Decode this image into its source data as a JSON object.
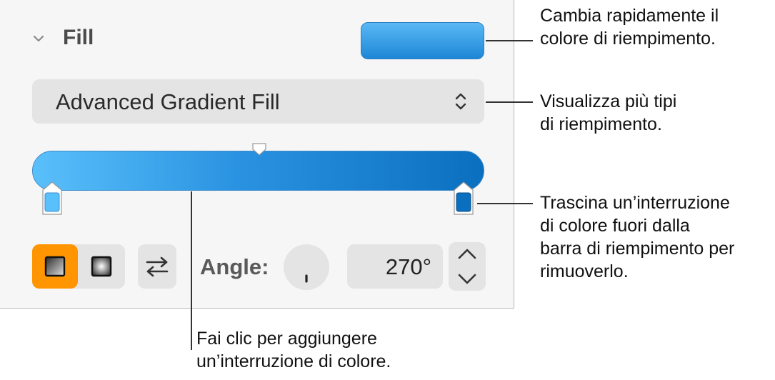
{
  "panel": {
    "section_title": "Fill",
    "fill_type": "Advanced Gradient Fill",
    "angle_label": "Angle:",
    "angle_value": "270°"
  },
  "colors": {
    "gradient_start": "#5ac0fb",
    "gradient_end": "#0b6fbf",
    "active_accent": "#ff9500"
  },
  "icons": [
    "chevron-down-icon",
    "up-down-chevron-icon",
    "linear-gradient-icon",
    "radial-gradient-icon",
    "swap-arrows-icon",
    "angle-wheel-icon",
    "chevron-up-icon",
    "chevron-down-small-icon"
  ],
  "callouts": {
    "fill_color": "Cambia rapidamente il\ncolore di riempimento.",
    "fill_types": "Visualizza più tipi\ndi riempimento.",
    "color_stop": "Trascina un’interruzione\ndi colore fuori dalla\nbarra di riempimento per\nrimuoverlo.",
    "add_stop": "Fai clic per aggiungere\nun’interruzione di colore."
  }
}
